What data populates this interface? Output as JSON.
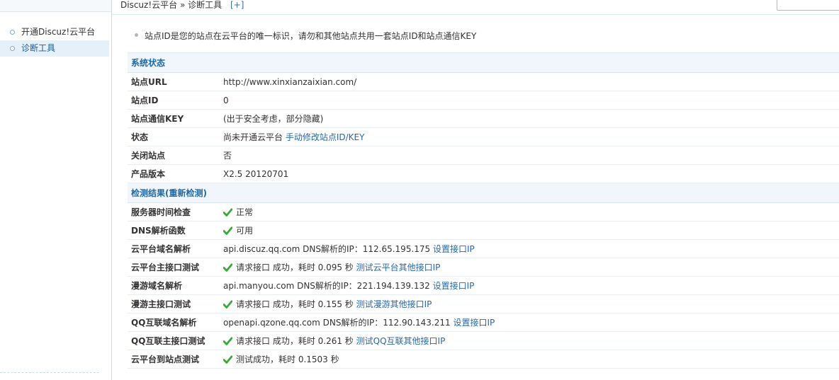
{
  "header": {
    "breadcrumb_root": "Discuz!云平台",
    "breadcrumb_sep": " » ",
    "breadcrumb_current": "诊断工具",
    "add_label": "[+]"
  },
  "sidebar": {
    "items": [
      {
        "label": "开通Discuz!云平台",
        "active": false
      },
      {
        "label": "诊断工具",
        "active": true
      }
    ]
  },
  "tip": "站点ID是您的站点在云平台的唯一标识，请勿和其他站点共用一套站点ID和站点通信KEY",
  "system_status": {
    "title": "系统状态",
    "site_url_label": "站点URL",
    "site_url": "http://www.xinxianzaixian.com/",
    "site_id_label": "站点ID",
    "site_id": "0",
    "key_label": "站点通信KEY",
    "key_value": "(出于安全考虑，部分隐藏)",
    "status_label": "状态",
    "status_value": "尚未开通云平台",
    "status_link": "手动修改站点ID/KEY",
    "close_label": "关闭站点",
    "close_value": "否",
    "version_label": "产品版本",
    "version_value": "X2.5 20120701"
  },
  "checks": {
    "title": "检测结果",
    "recheck": "(重新检测)",
    "rows": [
      {
        "label": "服务器时间检查",
        "ok": true,
        "text": "正常",
        "link": ""
      },
      {
        "label": "DNS解析函数",
        "ok": true,
        "text": "可用",
        "link": ""
      },
      {
        "label": "云平台域名解析",
        "ok": false,
        "text": "api.discuz.qq.com DNS解析的IP：112.65.195.175",
        "link": "设置接口IP"
      },
      {
        "label": "云平台主接口测试",
        "ok": true,
        "text": "请求接口 成功，耗时 0.095 秒",
        "link": "测试云平台其他接口IP"
      },
      {
        "label": "漫游域名解析",
        "ok": false,
        "text": "api.manyou.com DNS解析的IP：221.194.139.132",
        "link": "设置接口IP"
      },
      {
        "label": "漫游主接口测试",
        "ok": true,
        "text": "请求接口 成功，耗时 0.155 秒",
        "link": "测试漫游其他接口IP"
      },
      {
        "label": "QQ互联域名解析",
        "ok": false,
        "text": "openapi.qzone.qq.com DNS解析的IP：112.90.143.211",
        "link": "设置接口IP"
      },
      {
        "label": "QQ互联主接口测试",
        "ok": true,
        "text": "请求接口 成功，耗时 0.261 秒",
        "link": "测试QQ互联其他接口IP"
      },
      {
        "label": "云平台到站点测试",
        "ok": true,
        "text": "测试成功，耗时 0.1503 秒",
        "link": ""
      }
    ]
  },
  "colors": {
    "check": "#3aa93a",
    "link": "#2a68a8",
    "section_title": "#1c6aa8"
  }
}
